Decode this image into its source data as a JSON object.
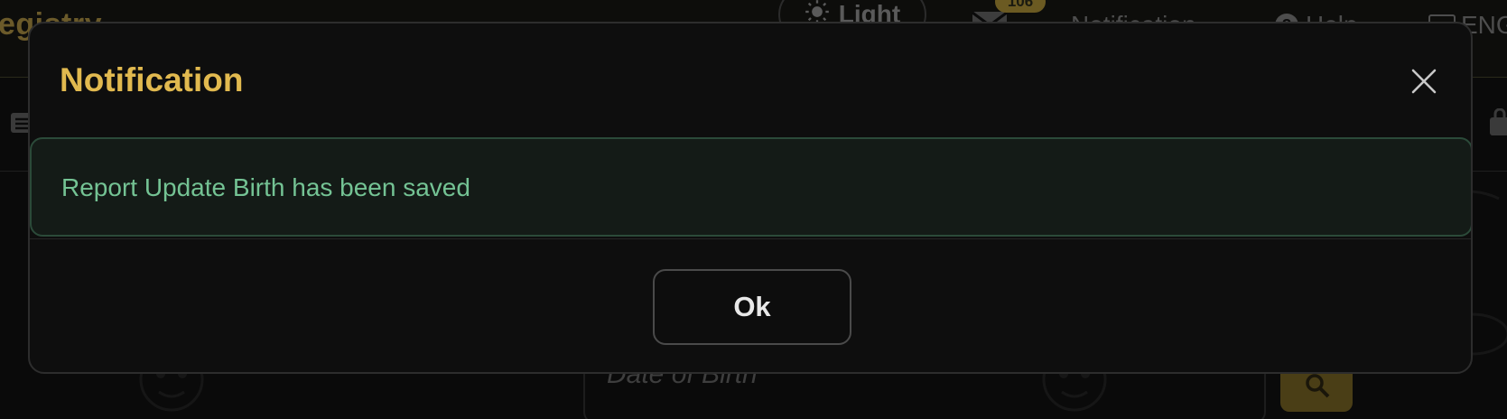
{
  "background": {
    "brand": "egistry",
    "theme_toggle": {
      "label": "Light",
      "icon": "sun-icon"
    },
    "mail": {
      "icon": "mail-icon",
      "badge": "106"
    },
    "notification_link": "Notification",
    "help_link": "Help",
    "language": "ENG",
    "date_of_birth_placeholder": "Date of Birth"
  },
  "modal": {
    "title": "Notification",
    "close_icon": "close-icon",
    "message": "Report Update Birth has been saved",
    "ok_label": "Ok"
  },
  "colors": {
    "title": "#e1b94f",
    "message": "#74c394",
    "alert_background": "#141b17",
    "alert_border": "#2b4a39",
    "modal_background": "#0e0e0e"
  }
}
